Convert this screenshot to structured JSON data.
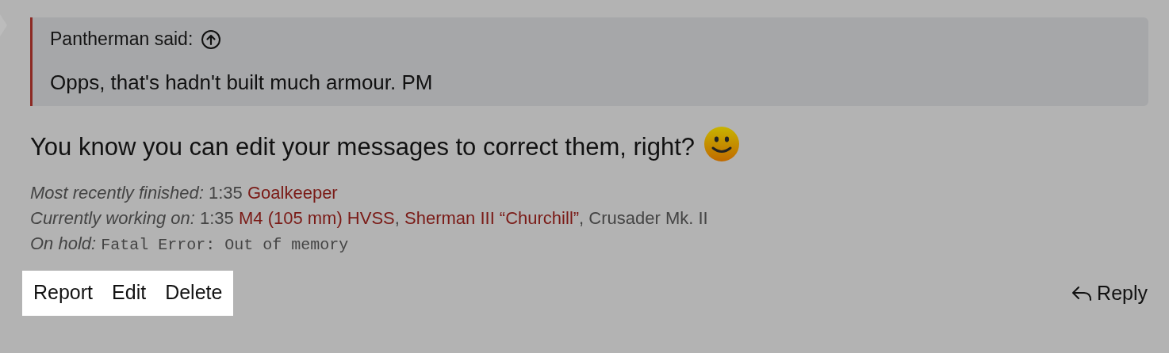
{
  "quote": {
    "author": "Pantherman said:",
    "text": "Opps, that's hadn't built much armour. PM"
  },
  "message": {
    "text": "You know you can edit your messages to correct them, right?"
  },
  "signature": [
    {
      "label": "Most recently finished:",
      "segments": [
        {
          "kind": "text",
          "text": "1:35"
        },
        {
          "kind": "link",
          "text": "Goalkeeper"
        }
      ]
    },
    {
      "label": "Currently working on:",
      "segments": [
        {
          "kind": "text",
          "text": "1:35"
        },
        {
          "kind": "link",
          "text": "M4 (105 mm) HVSS"
        },
        {
          "kind": "text",
          "text": ","
        },
        {
          "kind": "link",
          "text": "Sherman III “Churchill”"
        },
        {
          "kind": "text",
          "text": ", Crusader Mk. II"
        }
      ]
    },
    {
      "label": "On hold:",
      "segments": [
        {
          "kind": "code",
          "text": "Fatal Error: Out of memory"
        }
      ]
    }
  ],
  "actions": {
    "highlighted": true,
    "items": [
      "Report",
      "Edit",
      "Delete"
    ]
  },
  "reply": "Reply"
}
